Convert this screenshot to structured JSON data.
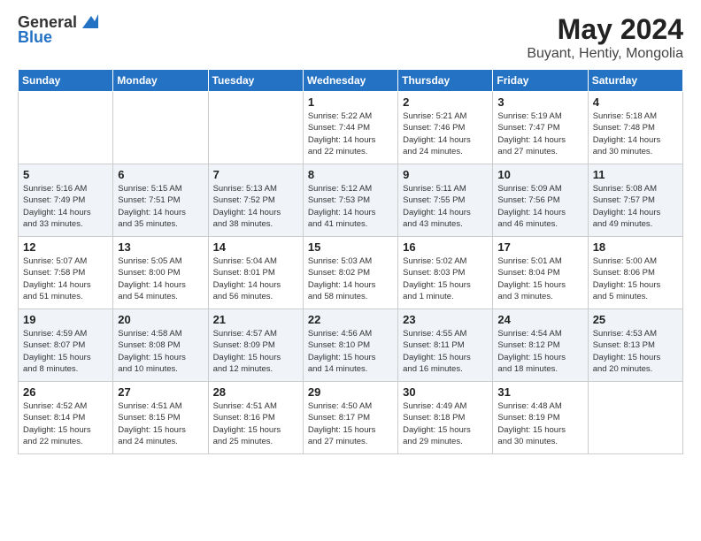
{
  "header": {
    "logo_general": "General",
    "logo_blue": "Blue",
    "title": "May 2024",
    "subtitle": "Buyant, Hentiy, Mongolia"
  },
  "weekdays": [
    "Sunday",
    "Monday",
    "Tuesday",
    "Wednesday",
    "Thursday",
    "Friday",
    "Saturday"
  ],
  "weeks": [
    [
      {
        "day": "",
        "info": ""
      },
      {
        "day": "",
        "info": ""
      },
      {
        "day": "",
        "info": ""
      },
      {
        "day": "1",
        "info": "Sunrise: 5:22 AM\nSunset: 7:44 PM\nDaylight: 14 hours\nand 22 minutes."
      },
      {
        "day": "2",
        "info": "Sunrise: 5:21 AM\nSunset: 7:46 PM\nDaylight: 14 hours\nand 24 minutes."
      },
      {
        "day": "3",
        "info": "Sunrise: 5:19 AM\nSunset: 7:47 PM\nDaylight: 14 hours\nand 27 minutes."
      },
      {
        "day": "4",
        "info": "Sunrise: 5:18 AM\nSunset: 7:48 PM\nDaylight: 14 hours\nand 30 minutes."
      }
    ],
    [
      {
        "day": "5",
        "info": "Sunrise: 5:16 AM\nSunset: 7:49 PM\nDaylight: 14 hours\nand 33 minutes."
      },
      {
        "day": "6",
        "info": "Sunrise: 5:15 AM\nSunset: 7:51 PM\nDaylight: 14 hours\nand 35 minutes."
      },
      {
        "day": "7",
        "info": "Sunrise: 5:13 AM\nSunset: 7:52 PM\nDaylight: 14 hours\nand 38 minutes."
      },
      {
        "day": "8",
        "info": "Sunrise: 5:12 AM\nSunset: 7:53 PM\nDaylight: 14 hours\nand 41 minutes."
      },
      {
        "day": "9",
        "info": "Sunrise: 5:11 AM\nSunset: 7:55 PM\nDaylight: 14 hours\nand 43 minutes."
      },
      {
        "day": "10",
        "info": "Sunrise: 5:09 AM\nSunset: 7:56 PM\nDaylight: 14 hours\nand 46 minutes."
      },
      {
        "day": "11",
        "info": "Sunrise: 5:08 AM\nSunset: 7:57 PM\nDaylight: 14 hours\nand 49 minutes."
      }
    ],
    [
      {
        "day": "12",
        "info": "Sunrise: 5:07 AM\nSunset: 7:58 PM\nDaylight: 14 hours\nand 51 minutes."
      },
      {
        "day": "13",
        "info": "Sunrise: 5:05 AM\nSunset: 8:00 PM\nDaylight: 14 hours\nand 54 minutes."
      },
      {
        "day": "14",
        "info": "Sunrise: 5:04 AM\nSunset: 8:01 PM\nDaylight: 14 hours\nand 56 minutes."
      },
      {
        "day": "15",
        "info": "Sunrise: 5:03 AM\nSunset: 8:02 PM\nDaylight: 14 hours\nand 58 minutes."
      },
      {
        "day": "16",
        "info": "Sunrise: 5:02 AM\nSunset: 8:03 PM\nDaylight: 15 hours\nand 1 minute."
      },
      {
        "day": "17",
        "info": "Sunrise: 5:01 AM\nSunset: 8:04 PM\nDaylight: 15 hours\nand 3 minutes."
      },
      {
        "day": "18",
        "info": "Sunrise: 5:00 AM\nSunset: 8:06 PM\nDaylight: 15 hours\nand 5 minutes."
      }
    ],
    [
      {
        "day": "19",
        "info": "Sunrise: 4:59 AM\nSunset: 8:07 PM\nDaylight: 15 hours\nand 8 minutes."
      },
      {
        "day": "20",
        "info": "Sunrise: 4:58 AM\nSunset: 8:08 PM\nDaylight: 15 hours\nand 10 minutes."
      },
      {
        "day": "21",
        "info": "Sunrise: 4:57 AM\nSunset: 8:09 PM\nDaylight: 15 hours\nand 12 minutes."
      },
      {
        "day": "22",
        "info": "Sunrise: 4:56 AM\nSunset: 8:10 PM\nDaylight: 15 hours\nand 14 minutes."
      },
      {
        "day": "23",
        "info": "Sunrise: 4:55 AM\nSunset: 8:11 PM\nDaylight: 15 hours\nand 16 minutes."
      },
      {
        "day": "24",
        "info": "Sunrise: 4:54 AM\nSunset: 8:12 PM\nDaylight: 15 hours\nand 18 minutes."
      },
      {
        "day": "25",
        "info": "Sunrise: 4:53 AM\nSunset: 8:13 PM\nDaylight: 15 hours\nand 20 minutes."
      }
    ],
    [
      {
        "day": "26",
        "info": "Sunrise: 4:52 AM\nSunset: 8:14 PM\nDaylight: 15 hours\nand 22 minutes."
      },
      {
        "day": "27",
        "info": "Sunrise: 4:51 AM\nSunset: 8:15 PM\nDaylight: 15 hours\nand 24 minutes."
      },
      {
        "day": "28",
        "info": "Sunrise: 4:51 AM\nSunset: 8:16 PM\nDaylight: 15 hours\nand 25 minutes."
      },
      {
        "day": "29",
        "info": "Sunrise: 4:50 AM\nSunset: 8:17 PM\nDaylight: 15 hours\nand 27 minutes."
      },
      {
        "day": "30",
        "info": "Sunrise: 4:49 AM\nSunset: 8:18 PM\nDaylight: 15 hours\nand 29 minutes."
      },
      {
        "day": "31",
        "info": "Sunrise: 4:48 AM\nSunset: 8:19 PM\nDaylight: 15 hours\nand 30 minutes."
      },
      {
        "day": "",
        "info": ""
      }
    ]
  ]
}
